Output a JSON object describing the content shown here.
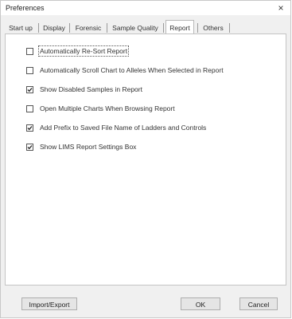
{
  "window": {
    "title": "Preferences",
    "close_symbol": "×"
  },
  "tabs": [
    {
      "label": "Start up",
      "active": false
    },
    {
      "label": "Display",
      "active": false
    },
    {
      "label": "Forensic",
      "active": false
    },
    {
      "label": "Sample Quality",
      "active": false
    },
    {
      "label": "Report",
      "active": true
    },
    {
      "label": "Others",
      "active": false
    }
  ],
  "options": [
    {
      "label": "Automatically Re-Sort Report",
      "checked": false,
      "focused": true
    },
    {
      "label": "Automatically Scroll Chart to Alleles When Selected in Report",
      "checked": false,
      "focused": false
    },
    {
      "label": "Show Disabled Samples in Report",
      "checked": true,
      "focused": false
    },
    {
      "label": "Open Multiple Charts When Browsing Report",
      "checked": false,
      "focused": false
    },
    {
      "label": "Add Prefix to Saved File Name of Ladders and Controls",
      "checked": true,
      "focused": false
    },
    {
      "label": "Show LIMS Report Settings Box",
      "checked": true,
      "focused": false
    }
  ],
  "buttons": {
    "import_export": "Import/Export",
    "ok": "OK",
    "cancel": "Cancel"
  },
  "icons": {
    "close": "close-icon",
    "checkmark": "checkmark-icon"
  }
}
